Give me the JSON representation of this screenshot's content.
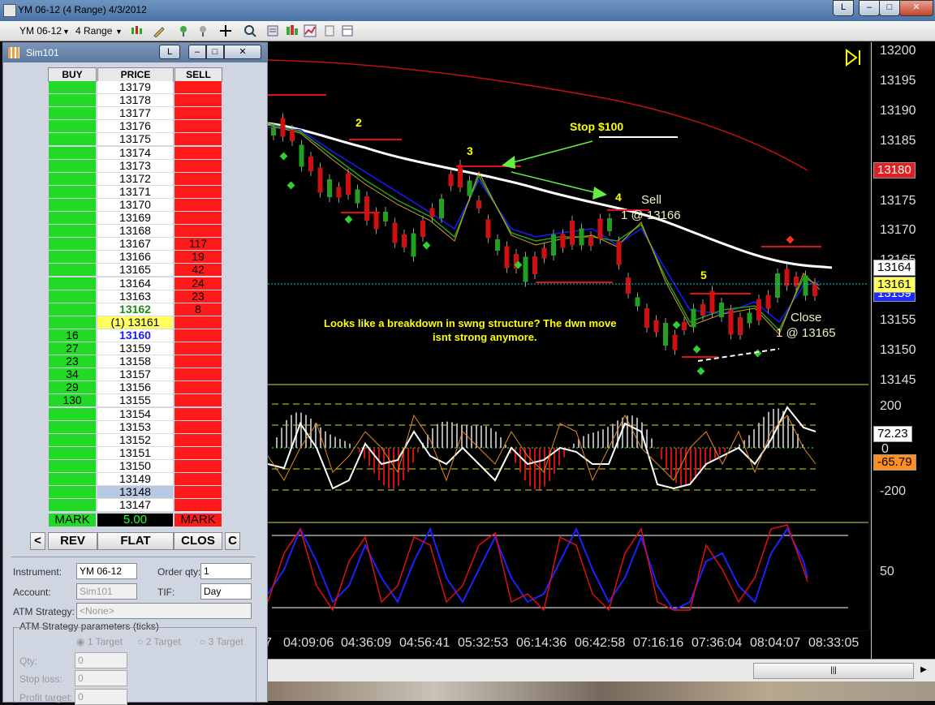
{
  "window": {
    "title": "YM 06-12 (4 Range)  4/3/2012",
    "btn_l": "L"
  },
  "toolbar": {
    "instrument": "YM 06-12",
    "period": "4 Range"
  },
  "dom": {
    "title": "Sim101",
    "btn_l": "L",
    "headers": {
      "buy": "BUY",
      "price": "PRICE",
      "sell": "SELL"
    },
    "prices": [
      "13179",
      "13178",
      "13177",
      "13176",
      "13175",
      "13174",
      "13173",
      "13172",
      "13171",
      "13170",
      "13169",
      "13168",
      "13167",
      "13166",
      "13165",
      "13164",
      "13163",
      "13162",
      "(1) 13161",
      "13160",
      "13159",
      "13158",
      "13157",
      "13156",
      "13155",
      "13154",
      "13153",
      "13152",
      "13151",
      "13150",
      "13149",
      "13148",
      "13147"
    ],
    "sell_sizes": [
      "",
      "",
      "",
      "",
      "",
      "",
      "",
      "",
      "",
      "",
      "",
      "",
      "117",
      "19",
      "42",
      "24",
      "23",
      "8",
      "",
      "",
      "",
      "",
      "",
      "",
      "",
      "",
      "",
      "",
      "",
      "",
      "",
      "",
      ""
    ],
    "buy_sizes": [
      "",
      "",
      "",
      "",
      "",
      "",
      "",
      "",
      "",
      "",
      "",
      "",
      "",
      "",
      "",
      "",
      "",
      "",
      "",
      "16",
      "27",
      "23",
      "34",
      "29",
      "130",
      "",
      "",
      "",
      "",
      "",
      "",
      "",
      ""
    ],
    "mark": {
      "buy": "MARK",
      "price": "5.00",
      "sell": "MARK"
    },
    "buttons": {
      "left": "<",
      "rev": "REV",
      "flat": "FLAT",
      "clos": "CLOS",
      "c": "C"
    },
    "form": {
      "instrument_label": "Instrument:",
      "instrument_value": "YM 06-12",
      "order_qty_label": "Order qty:",
      "order_qty_value": "1",
      "account_label": "Account:",
      "account_value": "Sim101",
      "tif_label": "TIF:",
      "tif_value": "Day",
      "atm_label": "ATM Strategy:",
      "atm_value": "<None>",
      "atm_params_label": "ATM Strategy parameters (ticks)",
      "target1": "1 Target",
      "target2": "2 Target",
      "target3": "3 Target",
      "qty_label": "Qty:",
      "qty_value": "0",
      "stop_label": "Stop loss:",
      "stop_value": "0",
      "profit_label": "Profit target:",
      "profit_value": "0"
    }
  },
  "chart": {
    "price_labels": [
      "13200",
      "13195",
      "13190",
      "13185",
      "13180",
      "13175",
      "13170",
      "13165",
      "13160",
      "13155",
      "13150",
      "13145"
    ],
    "tags": {
      "red": "13180",
      "white": "13164",
      "yellow": "13161",
      "blue": "13159"
    },
    "osc_labels": [
      "200",
      "0",
      "-200"
    ],
    "osc_tags": {
      "white": "72.23",
      "orange": "-65.79"
    },
    "stoch_label": "50",
    "time_labels": [
      "7",
      "04:09:06",
      "04:36:09",
      "04:56:41",
      "05:32:53",
      "06:14:36",
      "06:42:58",
      "07:16:16",
      "07:36:04",
      "08:04:07",
      "08:33:05"
    ],
    "annotations": {
      "n2": "2",
      "n3": "3",
      "n4": "4",
      "n5": "5",
      "stop": "Stop $100",
      "sell": "Sell",
      "sell_qty": "1 @ 13166",
      "close": "Close",
      "close_qty": "1 @ 13165",
      "note1": "Looks like a breakdown in swng structure? The dwn move",
      "note2": "isnt strong anymore."
    }
  },
  "colors": {
    "buy": "#22d928",
    "sell": "#ff1a1a",
    "annotation": "#ffff00"
  }
}
